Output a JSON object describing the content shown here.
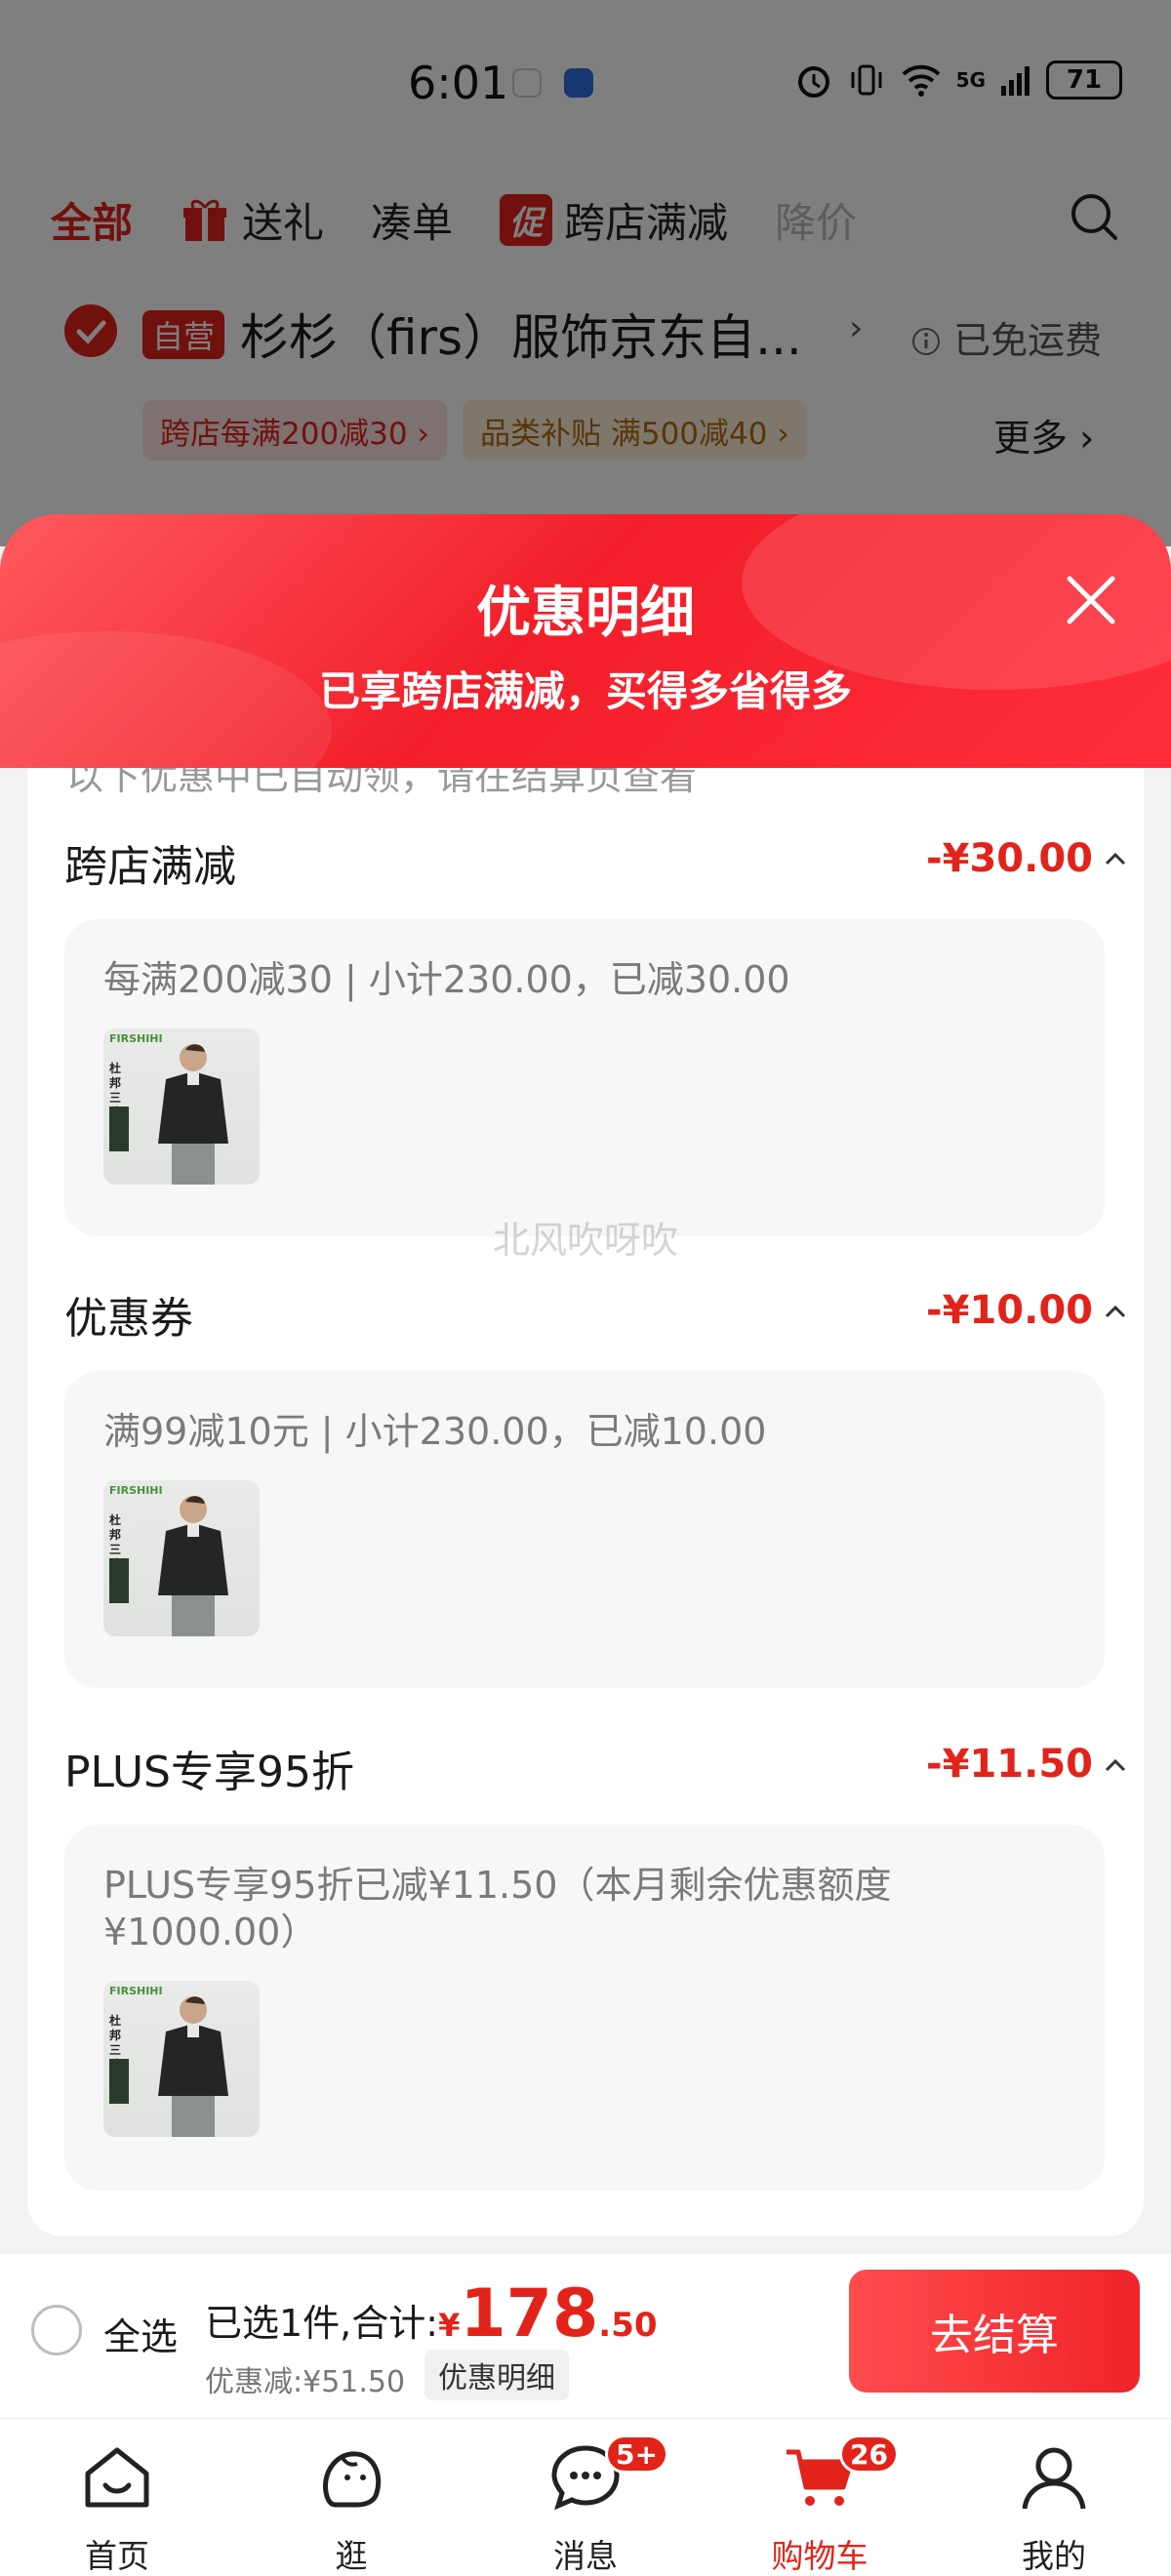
{
  "status_bar": {
    "time": "6:01",
    "network": "5G",
    "battery": "71"
  },
  "top_tabs": {
    "all": "全部",
    "gift": "送礼",
    "bundle": "凑单",
    "promo_badge": "促",
    "cross_store": "跨店满减",
    "price_drop": "降价"
  },
  "shop": {
    "self_badge": "自营",
    "name": "杉杉（firs）服饰京东自...",
    "arrow": "›",
    "shipping": "已免运费",
    "coupons": [
      "跨店每满200减30 ›",
      "品类补贴  满500减40 ›"
    ],
    "more": "更多 ›"
  },
  "sheet": {
    "title": "优惠明细",
    "subtitle": "已享跨店满减，买得多省得多",
    "cut_text": "以下优惠中已自动领，请在结算页查看",
    "sections": [
      {
        "title": "跨店满减",
        "amount": "-¥30.00",
        "detail": "每满200减30 | 小计230.00，已减30.00",
        "thumb_brand": "FIRSHIHI",
        "thumb_text": "杜邦三防"
      },
      {
        "title": "优惠券",
        "amount": "-¥10.00",
        "detail": "满99减10元 | 小计230.00，已减10.00",
        "thumb_brand": "FIRSHIHI",
        "thumb_text": "杜邦三防"
      },
      {
        "title": "PLUS专享95折",
        "amount": "-¥11.50",
        "detail": "PLUS专享95折已减¥11.50（本月剩余优惠额度¥1000.00）",
        "thumb_brand": "FIRSHIHI",
        "thumb_text": "杜邦三防"
      }
    ]
  },
  "watermark": "北风吹呀吹",
  "checkout": {
    "select_all": "全选",
    "total_label": "已选1件,合计:",
    "currency": "¥",
    "total_int": "178",
    "total_dec": ".50",
    "saved": "优惠减:¥51.50",
    "detail_btn": "优惠明细",
    "checkout_btn": "去结算"
  },
  "nav": {
    "home": "首页",
    "browse": "逛",
    "messages": "消息",
    "messages_badge": "5+",
    "cart": "购物车",
    "cart_badge": "26",
    "mine": "我的"
  },
  "colors": {
    "accent": "#e2231a",
    "sheet_gradient_start": "#ff5a5f",
    "sheet_gradient_end": "#f21f2a"
  }
}
